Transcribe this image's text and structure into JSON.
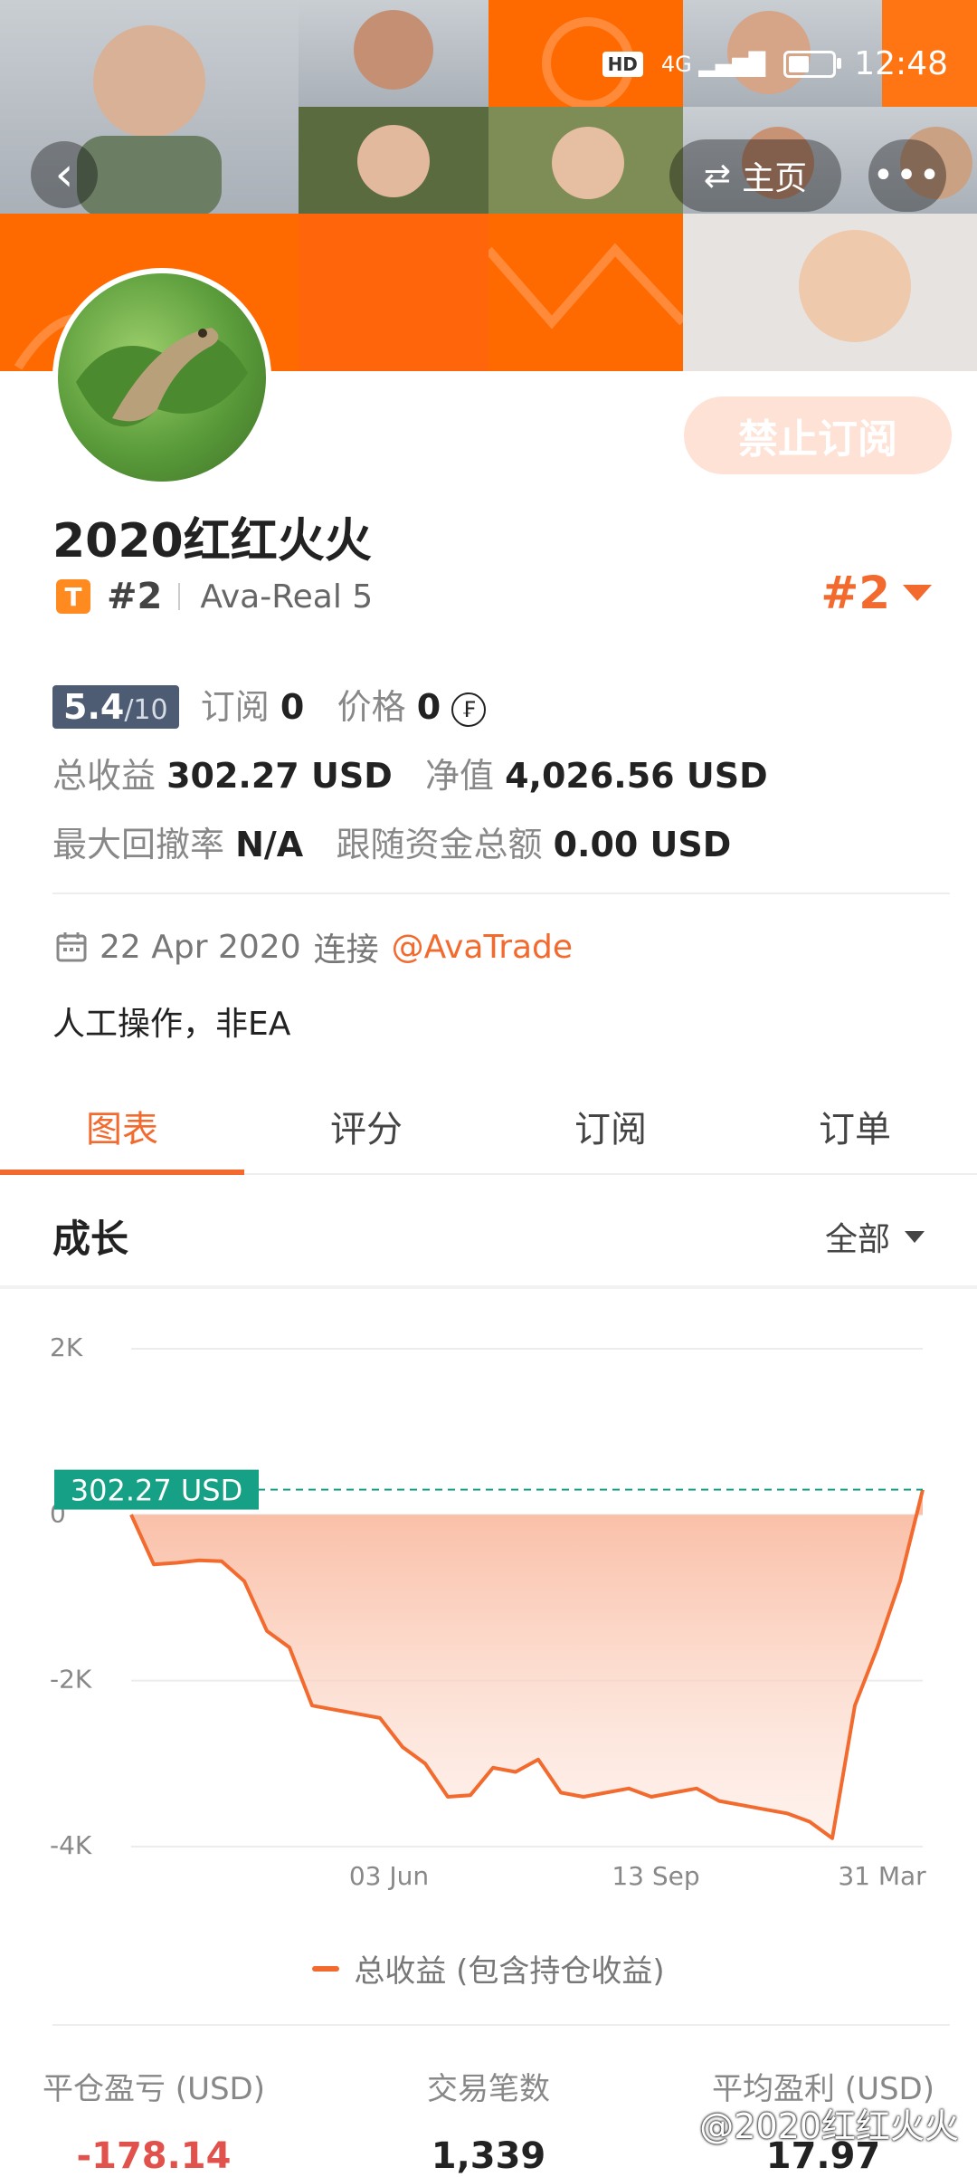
{
  "status_bar": {
    "hd": "HD",
    "signal": "4G",
    "time": "12:48"
  },
  "nav": {
    "home_label": "主页"
  },
  "profile": {
    "subscribe_button": "禁止订阅",
    "name": "2020红红火火",
    "badge_letter": "T",
    "rank": "#2",
    "account": "Ava-Real 5",
    "rank_right": "#2"
  },
  "stats": {
    "score": "5.4",
    "score_max": "/10",
    "subscriptions_label": "订阅",
    "subscriptions_value": "0",
    "price_label": "价格",
    "price_value": "0",
    "coin_icon": "coin-icon",
    "total_profit_label": "总收益",
    "total_profit_value": "302.27 USD",
    "equity_label": "净值",
    "equity_value": "4,026.56 USD",
    "max_drawdown_label": "最大回撤率",
    "max_drawdown_value": "N/A",
    "follow_total_label": "跟随资金总额",
    "follow_total_value": "0.00 USD"
  },
  "connection": {
    "date": "22 Apr 2020",
    "connect_text": "连接",
    "broker": "@AvaTrade"
  },
  "description": "人工操作，非EA",
  "tabs": [
    {
      "label": "图表",
      "active": true
    },
    {
      "label": "评分",
      "active": false
    },
    {
      "label": "订阅",
      "active": false
    },
    {
      "label": "订单",
      "active": false
    }
  ],
  "section": {
    "title": "成长",
    "filter": "全部"
  },
  "chart_data": {
    "type": "area",
    "title": "",
    "current_value_label": "302.27 USD",
    "current_value": 302.27,
    "y_ticks": [
      "2K",
      "0",
      "-2K",
      "-4K"
    ],
    "ylim": [
      -4000,
      2000
    ],
    "x_ticks": [
      "03 Jun",
      "13 Sep",
      "31 Mar"
    ],
    "series": [
      {
        "name": "总收益 (包含持仓收益)",
        "color": "#f26a2e",
        "values": [
          0,
          -600,
          -580,
          -550,
          -560,
          -800,
          -1400,
          -1600,
          -2300,
          -2350,
          -2400,
          -2450,
          -2800,
          -3000,
          -3400,
          -3380,
          -3050,
          -3100,
          -2950,
          -3350,
          -3400,
          -3350,
          -3300,
          -3400,
          -3350,
          -3300,
          -3450,
          -3500,
          -3550,
          -3600,
          -3700,
          -3900,
          -2300,
          -1600,
          -800,
          300
        ]
      }
    ],
    "legend": "总收益 (包含持仓收益)"
  },
  "summary": [
    {
      "label": "平仓盈亏 (USD)",
      "value": "-178.14",
      "negative": true
    },
    {
      "label": "交易笔数",
      "value": "1,339",
      "negative": false
    },
    {
      "label": "平均盈利 (USD)",
      "value": "17.97",
      "negative": false
    }
  ],
  "watermark": "@2020红红火火"
}
